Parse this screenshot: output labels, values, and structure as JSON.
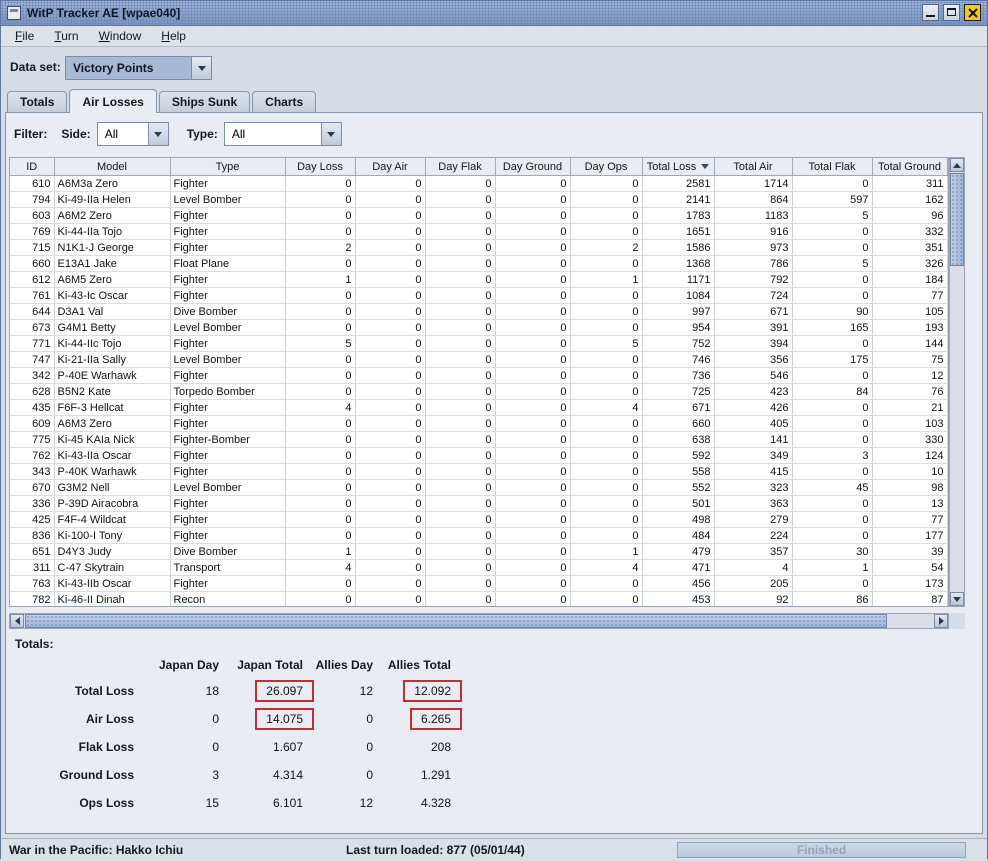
{
  "window": {
    "title": "WitP Tracker AE [wpae040]"
  },
  "menu": {
    "items": [
      "File",
      "Turn",
      "Window",
      "Help"
    ]
  },
  "dataset": {
    "label": "Data set:",
    "value": "Victory Points"
  },
  "tabs": {
    "totals": "Totals",
    "air_losses": "Air Losses",
    "ships_sunk": "Ships Sunk",
    "charts": "Charts",
    "selected": "Air Losses"
  },
  "filter": {
    "label": "Filter:",
    "side_label": "Side:",
    "side_value": "All",
    "type_label": "Type:",
    "type_value": "All"
  },
  "table": {
    "columns": [
      "ID",
      "Model",
      "Type",
      "Day Loss",
      "Day Air",
      "Day Flak",
      "Day Ground",
      "Day Ops",
      "Total Loss",
      "Total Air",
      "Total Flak",
      "Total Ground"
    ],
    "sort": {
      "column": "Total Loss",
      "direction": "descending"
    },
    "rows": [
      [
        "610",
        "A6M3a Zero",
        "Fighter",
        "0",
        "0",
        "0",
        "0",
        "0",
        "2581",
        "1714",
        "0",
        "311"
      ],
      [
        "794",
        "Ki-49-IIa Helen",
        "Level Bomber",
        "0",
        "0",
        "0",
        "0",
        "0",
        "2141",
        "864",
        "597",
        "162"
      ],
      [
        "603",
        "A6M2 Zero",
        "Fighter",
        "0",
        "0",
        "0",
        "0",
        "0",
        "1783",
        "1183",
        "5",
        "96"
      ],
      [
        "769",
        "Ki-44-IIa Tojo",
        "Fighter",
        "0",
        "0",
        "0",
        "0",
        "0",
        "1651",
        "916",
        "0",
        "332"
      ],
      [
        "715",
        "N1K1-J George",
        "Fighter",
        "2",
        "0",
        "0",
        "0",
        "2",
        "1586",
        "973",
        "0",
        "351"
      ],
      [
        "660",
        "E13A1 Jake",
        "Float Plane",
        "0",
        "0",
        "0",
        "0",
        "0",
        "1368",
        "786",
        "5",
        "326"
      ],
      [
        "612",
        "A6M5 Zero",
        "Fighter",
        "1",
        "0",
        "0",
        "0",
        "1",
        "1171",
        "792",
        "0",
        "184"
      ],
      [
        "761",
        "Ki-43-Ic Oscar",
        "Fighter",
        "0",
        "0",
        "0",
        "0",
        "0",
        "1084",
        "724",
        "0",
        "77"
      ],
      [
        "644",
        "D3A1 Val",
        "Dive Bomber",
        "0",
        "0",
        "0",
        "0",
        "0",
        "997",
        "671",
        "90",
        "105"
      ],
      [
        "673",
        "G4M1 Betty",
        "Level Bomber",
        "0",
        "0",
        "0",
        "0",
        "0",
        "954",
        "391",
        "165",
        "193"
      ],
      [
        "771",
        "Ki-44-IIc Tojo",
        "Fighter",
        "5",
        "0",
        "0",
        "0",
        "5",
        "752",
        "394",
        "0",
        "144"
      ],
      [
        "747",
        "Ki-21-IIa Sally",
        "Level Bomber",
        "0",
        "0",
        "0",
        "0",
        "0",
        "746",
        "356",
        "175",
        "75"
      ],
      [
        "342",
        "P-40E Warhawk",
        "Fighter",
        "0",
        "0",
        "0",
        "0",
        "0",
        "736",
        "546",
        "0",
        "12"
      ],
      [
        "628",
        "B5N2 Kate",
        "Torpedo Bomber",
        "0",
        "0",
        "0",
        "0",
        "0",
        "725",
        "423",
        "84",
        "76"
      ],
      [
        "435",
        "F6F-3 Hellcat",
        "Fighter",
        "4",
        "0",
        "0",
        "0",
        "4",
        "671",
        "426",
        "0",
        "21"
      ],
      [
        "609",
        "A6M3 Zero",
        "Fighter",
        "0",
        "0",
        "0",
        "0",
        "0",
        "660",
        "405",
        "0",
        "103"
      ],
      [
        "775",
        "Ki-45 KAIa Nick",
        "Fighter-Bomber",
        "0",
        "0",
        "0",
        "0",
        "0",
        "638",
        "141",
        "0",
        "330"
      ],
      [
        "762",
        "Ki-43-IIa Oscar",
        "Fighter",
        "0",
        "0",
        "0",
        "0",
        "0",
        "592",
        "349",
        "3",
        "124"
      ],
      [
        "343",
        "P-40K Warhawk",
        "Fighter",
        "0",
        "0",
        "0",
        "0",
        "0",
        "558",
        "415",
        "0",
        "10"
      ],
      [
        "670",
        "G3M2 Nell",
        "Level Bomber",
        "0",
        "0",
        "0",
        "0",
        "0",
        "552",
        "323",
        "45",
        "98"
      ],
      [
        "336",
        "P-39D Airacobra",
        "Fighter",
        "0",
        "0",
        "0",
        "0",
        "0",
        "501",
        "363",
        "0",
        "13"
      ],
      [
        "425",
        "F4F-4 Wildcat",
        "Fighter",
        "0",
        "0",
        "0",
        "0",
        "0",
        "498",
        "279",
        "0",
        "77"
      ],
      [
        "836",
        "Ki-100-I Tony",
        "Fighter",
        "0",
        "0",
        "0",
        "0",
        "0",
        "484",
        "224",
        "0",
        "177"
      ],
      [
        "651",
        "D4Y3 Judy",
        "Dive Bomber",
        "1",
        "0",
        "0",
        "0",
        "1",
        "479",
        "357",
        "30",
        "39"
      ],
      [
        "311",
        "C-47 Skytrain",
        "Transport",
        "4",
        "0",
        "0",
        "0",
        "4",
        "471",
        "4",
        "1",
        "54"
      ],
      [
        "763",
        "Ki-43-IIb Oscar",
        "Fighter",
        "0",
        "0",
        "0",
        "0",
        "0",
        "456",
        "205",
        "0",
        "173"
      ],
      [
        "782",
        "Ki-46-II Dinah",
        "Recon",
        "0",
        "0",
        "0",
        "0",
        "0",
        "453",
        "92",
        "86",
        "87"
      ]
    ]
  },
  "totals": {
    "label": "Totals:",
    "columns": [
      "Japan Day",
      "Japan Total",
      "Allies Day",
      "Allies Total"
    ],
    "rows": [
      {
        "label": "Total Loss",
        "values": [
          "18",
          "26.097",
          "12",
          "12.092"
        ],
        "boxed": [
          1,
          3
        ]
      },
      {
        "label": "Air Loss",
        "values": [
          "0",
          "14.075",
          "0",
          "6.265"
        ],
        "boxed": [
          1,
          3
        ]
      },
      {
        "label": "Flak Loss",
        "values": [
          "0",
          "1.607",
          "0",
          "208"
        ],
        "boxed": []
      },
      {
        "label": "Ground Loss",
        "values": [
          "3",
          "4.314",
          "0",
          "1.291"
        ],
        "boxed": []
      },
      {
        "label": "Ops Loss",
        "values": [
          "15",
          "6.101",
          "12",
          "4.328"
        ],
        "boxed": []
      }
    ]
  },
  "statusbar": {
    "left": "War in the Pacific: Hakko Ichiu",
    "center": "Last turn loaded: 877 (05/01/44)",
    "progress_label": "Finished"
  },
  "icons": {
    "minimize": "minimize-window",
    "maximize": "maximize-window",
    "close": "close-window",
    "dropdown": "chevron-down",
    "sort": "sort-descending"
  },
  "colors": {
    "accent_red": "#c03030",
    "titlebar_blue": "#8ba3cd",
    "panel_bg": "#e9edf3"
  }
}
